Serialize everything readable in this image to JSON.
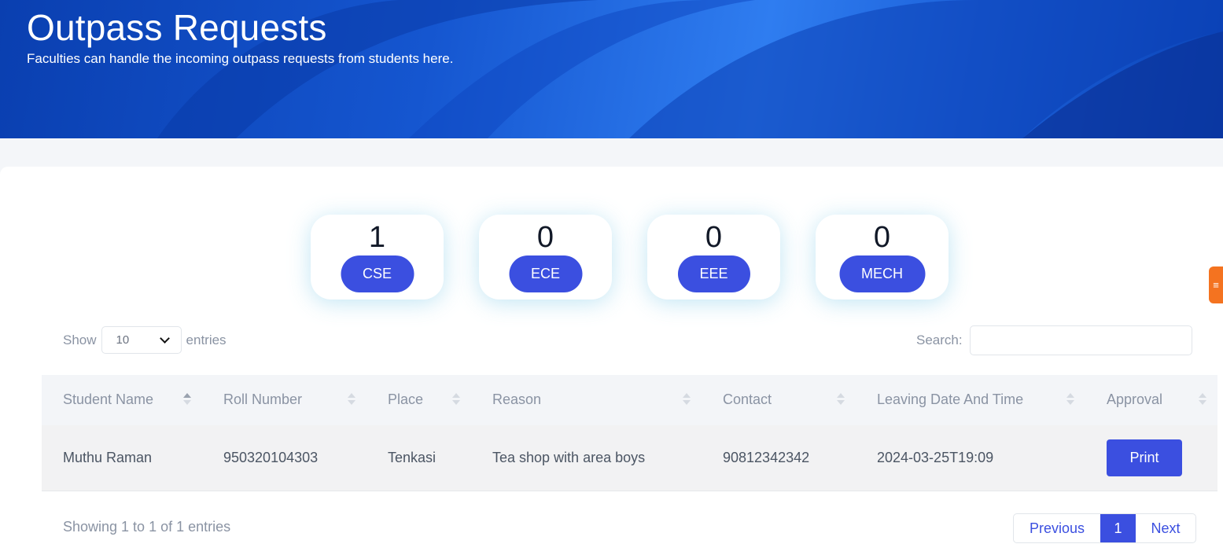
{
  "header": {
    "title": "Outpass Requests",
    "subtitle": "Faculties can handle the incoming outpass requests from students here."
  },
  "departments": [
    {
      "count": "1",
      "label": "CSE"
    },
    {
      "count": "0",
      "label": "ECE"
    },
    {
      "count": "0",
      "label": "EEE"
    },
    {
      "count": "0",
      "label": "MECH"
    }
  ],
  "side_tab": {
    "icon": "feedback-icon",
    "color": "#f47320"
  },
  "controls": {
    "show_label": "Show",
    "entries_value": "10",
    "entries_label": "entries",
    "search_label": "Search:",
    "search_value": ""
  },
  "table": {
    "columns": [
      "Student Name",
      "Roll Number",
      "Place",
      "Reason",
      "Contact",
      "Leaving Date And Time",
      "Approval"
    ],
    "sorted_column": "Student Name",
    "sort_direction": "ascending",
    "rows": [
      {
        "student_name": "Muthu Raman",
        "roll_number": "950320104303",
        "place": "Tenkasi",
        "reason": "Tea shop with area boys",
        "contact": "90812342342",
        "leaving": "2024-03-25T19:09",
        "action": "Print"
      }
    ]
  },
  "footer": {
    "info": "Showing 1 to 1 of 1 entries",
    "previous": "Previous",
    "current_page": "1",
    "next": "Next"
  },
  "colors": {
    "primary": "#3b4fe0",
    "hero_blue": "#1556d0",
    "accent_orange": "#f47320"
  }
}
